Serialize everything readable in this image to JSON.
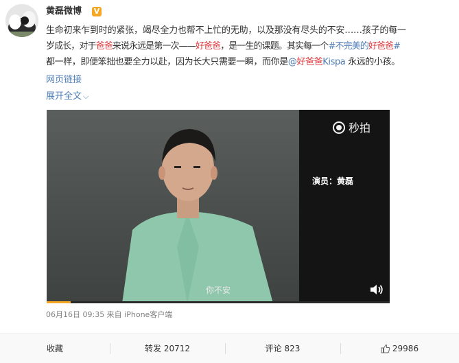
{
  "post": {
    "author": "黄磊微博",
    "text_lines": [
      [
        {
          "t": "生命初来乍到时的紧张，竭尽全力也帮不上忙的无助，以及那没有尽头的不安……孩子的每一",
          "c": ""
        }
      ],
      [
        {
          "t": "岁成长，对于",
          "c": ""
        },
        {
          "t": "爸爸",
          "c": "hl-red"
        },
        {
          "t": "来说永远是第一次——",
          "c": ""
        },
        {
          "t": "好爸爸",
          "c": "hl-red"
        },
        {
          "t": "，是一生的课题。其实每一个",
          "c": ""
        },
        {
          "t": "#不完美的",
          "c": "hl-blue"
        },
        {
          "t": "好爸爸",
          "c": "hl-red"
        },
        {
          "t": "#",
          "c": "hl-blue"
        }
      ],
      [
        {
          "t": "都一样，即便笨拙也要全力以赴，因为长大只需要一瞬，而你是",
          "c": ""
        },
        {
          "t": "@",
          "c": "hl-blue"
        },
        {
          "t": "好爸爸",
          "c": "hl-red"
        },
        {
          "t": "Kispa",
          "c": "hl-blue"
        },
        {
          "t": " 永远的小孩。",
          "c": ""
        }
      ]
    ],
    "web_link_label": "网页链接",
    "expand_label": "展开全文",
    "video": {
      "watermark": "秒拍",
      "credit": "演员：黄磊",
      "subtitle": "你不安",
      "progress": 0.07
    },
    "meta": "06月16日 09:35  来自 iPhone客户端"
  },
  "actions": {
    "favorite": "收藏",
    "repost": "转发 20712",
    "comment": "评论 823",
    "like": "29986"
  },
  "colors": {
    "link": "#4e7cb6",
    "highlight": "#e0393e",
    "badge": "#f5a623"
  },
  "icons": [
    "verified-v-icon",
    "chevron-down-icon",
    "miaopai-logo-icon",
    "speaker-icon",
    "thumbs-up-icon"
  ]
}
